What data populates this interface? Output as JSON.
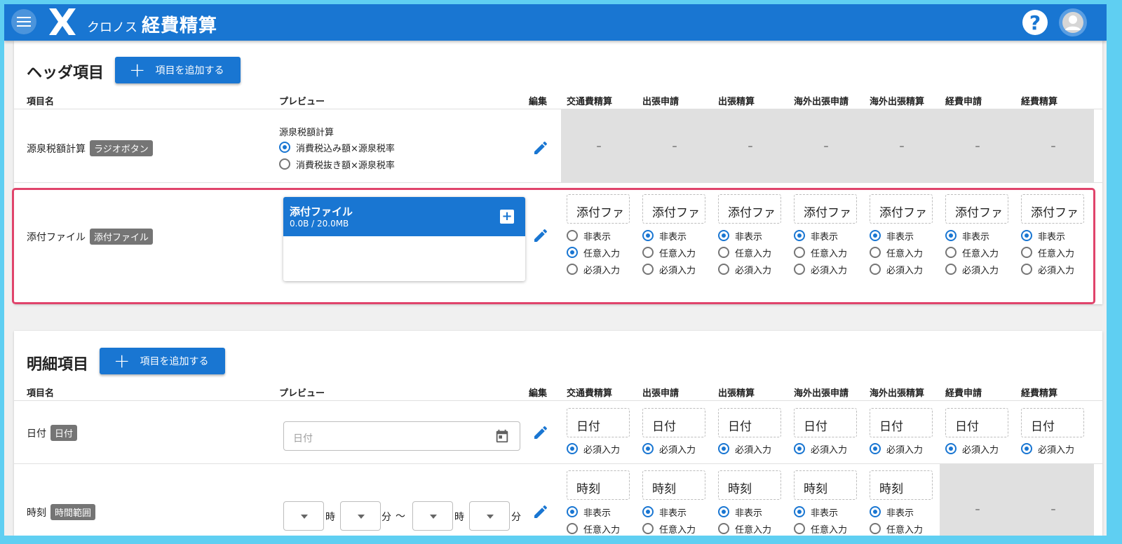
{
  "app": {
    "brand_small": "クロノス",
    "brand_large": "経費精算"
  },
  "header_section": {
    "title": "ヘッダ項目",
    "add_button": "項目を追加する",
    "columns": [
      "項目名",
      "プレビュー",
      "編集",
      "交通費精算",
      "出張申請",
      "出張精算",
      "海外出張申請",
      "海外出張精算",
      "経費申請",
      "経費精算"
    ],
    "rows": [
      {
        "name": "源泉税額計算",
        "type": "ラジオボタン",
        "preview_title": "源泉税額計算",
        "preview_options": [
          "消費税込み額×源泉税率",
          "消費税抜き額×源泉税率"
        ],
        "preview_selected": 0,
        "dash": "–"
      },
      {
        "name": "添付ファイル",
        "type": "添付ファイル",
        "file_title": "添付ファイル",
        "file_size": "0.0B / 20.0MB",
        "cell_text": "添付ファ",
        "options": [
          "非表示",
          "任意入力",
          "必須入力"
        ],
        "selected": [
          1,
          0,
          0,
          0,
          0,
          0,
          0
        ]
      }
    ]
  },
  "detail_section": {
    "title": "明細項目",
    "add_button": "項目を追加する",
    "columns": [
      "項目名",
      "プレビュー",
      "編集",
      "交通費精算",
      "出張申請",
      "出張精算",
      "海外出張申請",
      "海外出張精算",
      "経費申請",
      "経費精算"
    ],
    "rows": [
      {
        "name": "日付",
        "type": "日付",
        "placeholder": "日付",
        "cell_text": "日付",
        "option": "必須入力"
      },
      {
        "name": "時刻",
        "type": "時間範囲",
        "hour_label": "時",
        "minute_label": "分",
        "range_sep": "〜",
        "cell_text": "時刻",
        "options": [
          "非表示",
          "任意入力"
        ],
        "dash": "–"
      }
    ]
  },
  "colors": {
    "appbar": "#1976d2",
    "highlight": "#e0446b",
    "chip": "#757575",
    "disabled_cell": "#e0e0e0"
  },
  "icons": [
    "menu-icon",
    "logo-icon",
    "help-icon",
    "account-icon",
    "edit-icon",
    "add-icon",
    "calendar-icon",
    "dropdown-icon"
  ]
}
